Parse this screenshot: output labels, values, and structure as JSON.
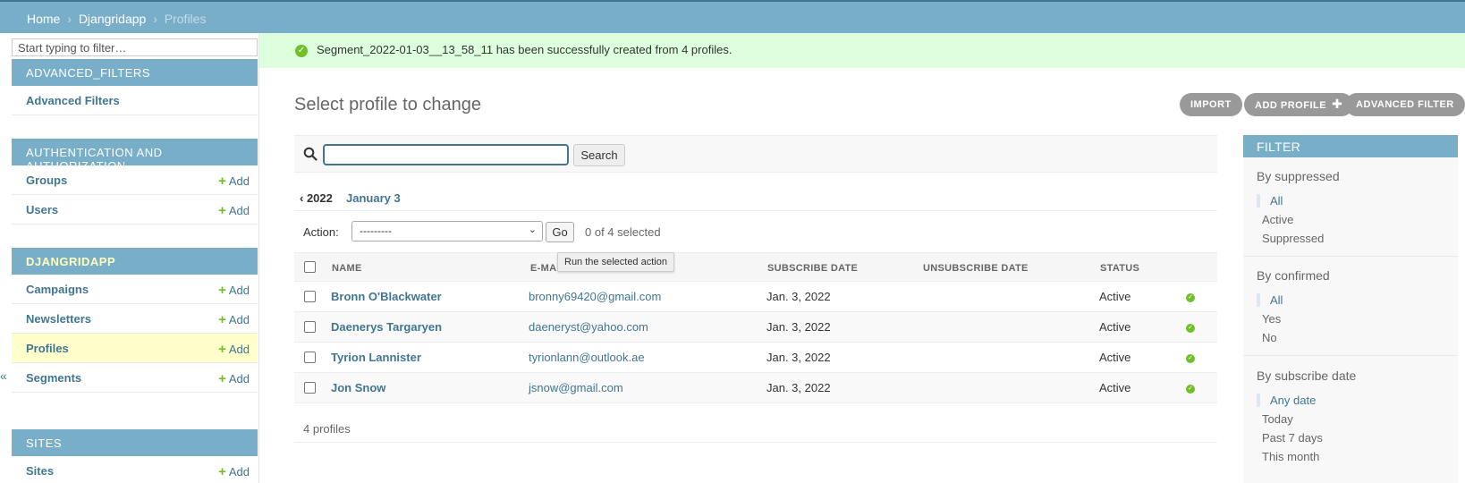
{
  "breadcrumbs": {
    "home": "Home",
    "sep1": "›",
    "app": "Djangridapp",
    "sep2": "›",
    "current": "Profiles"
  },
  "sidebar": {
    "filter_placeholder": "Start typing to filter…",
    "collapse_glyph": "«",
    "add_label": "Add",
    "apps": [
      {
        "caption": "ADVANCED_FILTERS",
        "models": [
          {
            "name": "Advanced Filters"
          }
        ]
      },
      {
        "caption": "AUTHENTICATION AND AUTHORIZATION",
        "models": [
          {
            "name": "Groups"
          },
          {
            "name": "Users"
          }
        ]
      },
      {
        "caption": "DJANGRIDAPP",
        "models": [
          {
            "name": "Campaigns"
          },
          {
            "name": "Newsletters"
          },
          {
            "name": "Profiles"
          },
          {
            "name": "Segments"
          }
        ]
      },
      {
        "caption": "SITES",
        "models": [
          {
            "name": "Sites"
          }
        ]
      }
    ]
  },
  "message": {
    "text": "Segment_2022-01-03__13_58_11 has been successfully created from 4 profiles.",
    "icon": "check-circle-icon"
  },
  "page": {
    "title": "Select profile to change"
  },
  "object_tools": {
    "import": "IMPORT",
    "add": "ADD PROFILE",
    "advanced": "ADVANCED FILTER"
  },
  "search": {
    "value": "",
    "button": "Search"
  },
  "date_hierarchy": {
    "back": "‹ 2022",
    "current": "January 3"
  },
  "actions": {
    "label": "Action:",
    "selected_option": "---------",
    "go": "Go",
    "count": "0 of 4 selected",
    "tooltip": "Run the selected action"
  },
  "table": {
    "columns": [
      "NAME",
      "E-MAIL",
      "SUBSCRIBE DATE",
      "UNSUBSCRIBE DATE",
      "STATUS"
    ],
    "rows": [
      {
        "name": "Bronn O'Blackwater",
        "email": "bronny69420@gmail.com",
        "subscribe_date": "Jan. 3, 2022",
        "unsubscribe_date": "",
        "status": "Active",
        "confirmed": true
      },
      {
        "name": "Daenerys Targaryen",
        "email": "daeneryst@yahoo.com",
        "subscribe_date": "Jan. 3, 2022",
        "unsubscribe_date": "",
        "status": "Active",
        "confirmed": true
      },
      {
        "name": "Tyrion Lannister",
        "email": "tyrionlann@outlook.ae",
        "subscribe_date": "Jan. 3, 2022",
        "unsubscribe_date": "",
        "status": "Active",
        "confirmed": true
      },
      {
        "name": "Jon Snow",
        "email": "jsnow@gmail.com",
        "subscribe_date": "Jan. 3, 2022",
        "unsubscribe_date": "",
        "status": "Active",
        "confirmed": true
      }
    ],
    "paginator": "4 profiles"
  },
  "filter": {
    "title": "FILTER",
    "groups": [
      {
        "title": "By suppressed",
        "options": [
          "All",
          "Active",
          "Suppressed"
        ],
        "selected": "All"
      },
      {
        "title": "By confirmed",
        "options": [
          "All",
          "Yes",
          "No"
        ],
        "selected": "All"
      },
      {
        "title": "By subscribe date",
        "options": [
          "Any date",
          "Today",
          "Past 7 days",
          "This month"
        ],
        "selected": "Any date"
      }
    ]
  },
  "colors": {
    "header": "#79aec8",
    "link": "#417690",
    "success_bg": "#dddddd",
    "add_green": "#70bf2b",
    "highlight": "#ffffcc"
  }
}
